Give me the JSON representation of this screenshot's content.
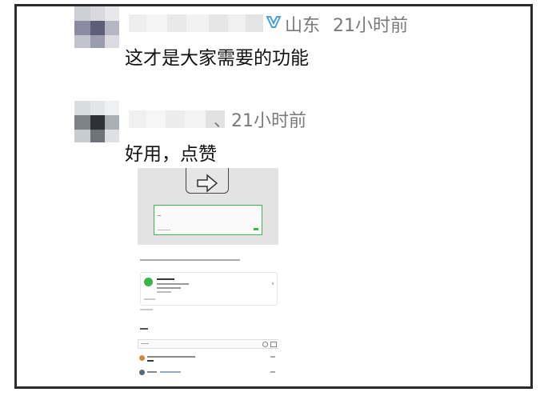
{
  "comments": [
    {
      "location_icon": "location-pin-icon",
      "location": "山东",
      "time": "21小时前",
      "text": "这才是大家需要的功能"
    },
    {
      "time": "、21小时前",
      "text": "好用，点赞"
    }
  ],
  "colors": {
    "meta_text": "#7a7a7a",
    "comment_text": "#111111",
    "location_icon": "#4a9fd6",
    "highlight_box": "#3cb54a",
    "frame_border": "#2b2b2b"
  },
  "attached_image": {
    "icon": "arrow-right-icon",
    "card_icon": "wechat-icon"
  }
}
